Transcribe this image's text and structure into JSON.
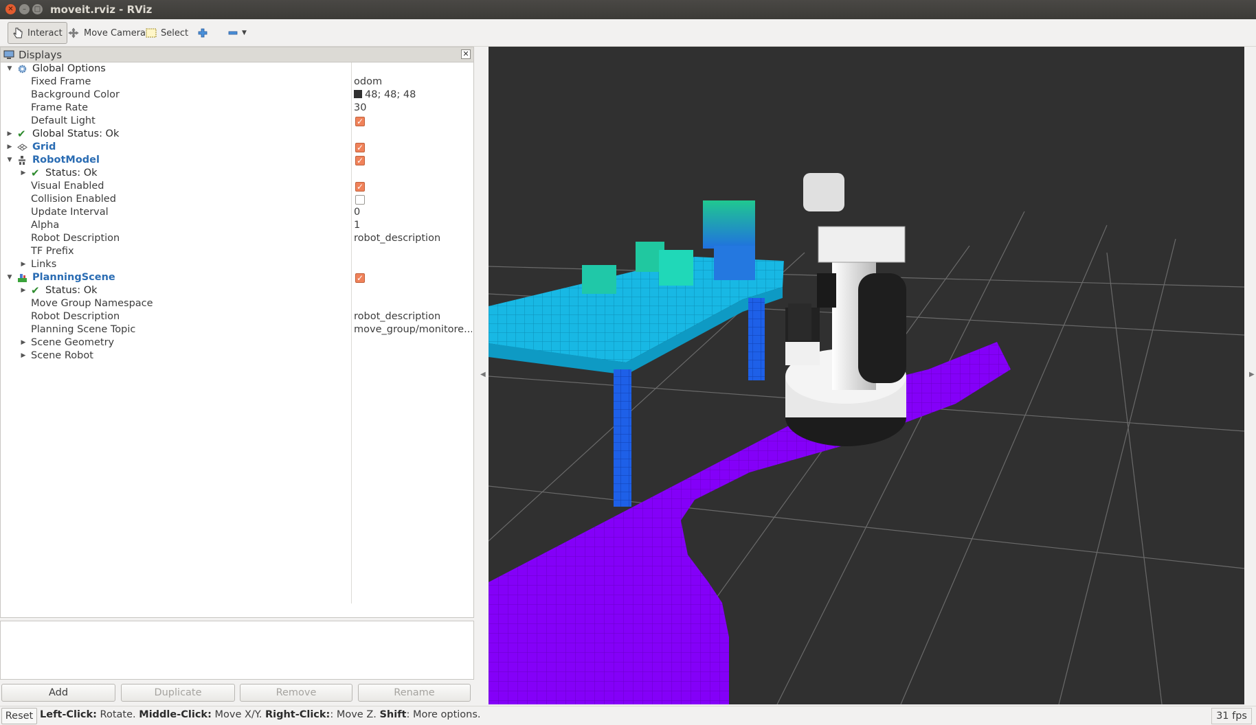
{
  "window": {
    "title": "moveit.rviz - RViz"
  },
  "toolbar": {
    "interact": "Interact",
    "move_camera": "Move Camera",
    "select": "Select"
  },
  "displays": {
    "title": "Displays",
    "rows": [
      {
        "label": "Global Options",
        "value": ""
      },
      {
        "label": "Fixed Frame",
        "value": "odom"
      },
      {
        "label": "Background Color",
        "value": "48; 48; 48"
      },
      {
        "label": "Frame Rate",
        "value": "30"
      },
      {
        "label": "Default Light",
        "value": ""
      },
      {
        "label": "Global Status: Ok",
        "value": ""
      },
      {
        "label": "Grid",
        "value": ""
      },
      {
        "label": "RobotModel",
        "value": ""
      },
      {
        "label": "Status: Ok",
        "value": ""
      },
      {
        "label": "Visual Enabled",
        "value": ""
      },
      {
        "label": "Collision Enabled",
        "value": ""
      },
      {
        "label": "Update Interval",
        "value": "0"
      },
      {
        "label": "Alpha",
        "value": "1"
      },
      {
        "label": "Robot Description",
        "value": "robot_description"
      },
      {
        "label": "TF Prefix",
        "value": ""
      },
      {
        "label": "Links",
        "value": ""
      },
      {
        "label": "PlanningScene",
        "value": ""
      },
      {
        "label": "Status: Ok",
        "value": ""
      },
      {
        "label": "Move Group Namespace",
        "value": ""
      },
      {
        "label": "Robot Description",
        "value": "robot_description"
      },
      {
        "label": "Planning Scene Topic",
        "value": "move_group/monitore..."
      },
      {
        "label": "Scene Geometry",
        "value": ""
      },
      {
        "label": "Scene Robot",
        "value": ""
      }
    ],
    "background_color_hex": "#303030",
    "checkbox_on_color": "#f0825a"
  },
  "buttons": {
    "add": "Add",
    "duplicate": "Duplicate",
    "remove": "Remove",
    "rename": "Rename"
  },
  "status": {
    "reset": "Reset",
    "left_click_key": "Left-Click:",
    "left_click_desc": " Rotate. ",
    "middle_click_key": "Middle-Click:",
    "middle_click_desc": " Move X/Y. ",
    "right_click_key": "Right-Click:",
    "right_click_desc": ": Move Z. ",
    "shift_key": "Shift",
    "shift_desc": ": More options.",
    "fps": "31 fps"
  },
  "scene": {
    "floor_voxel_color": "#8a00ff",
    "table_top_color": "#14b4e0",
    "table_leg_color": "#1e5ae6",
    "object_color": "#1ec8a0"
  }
}
